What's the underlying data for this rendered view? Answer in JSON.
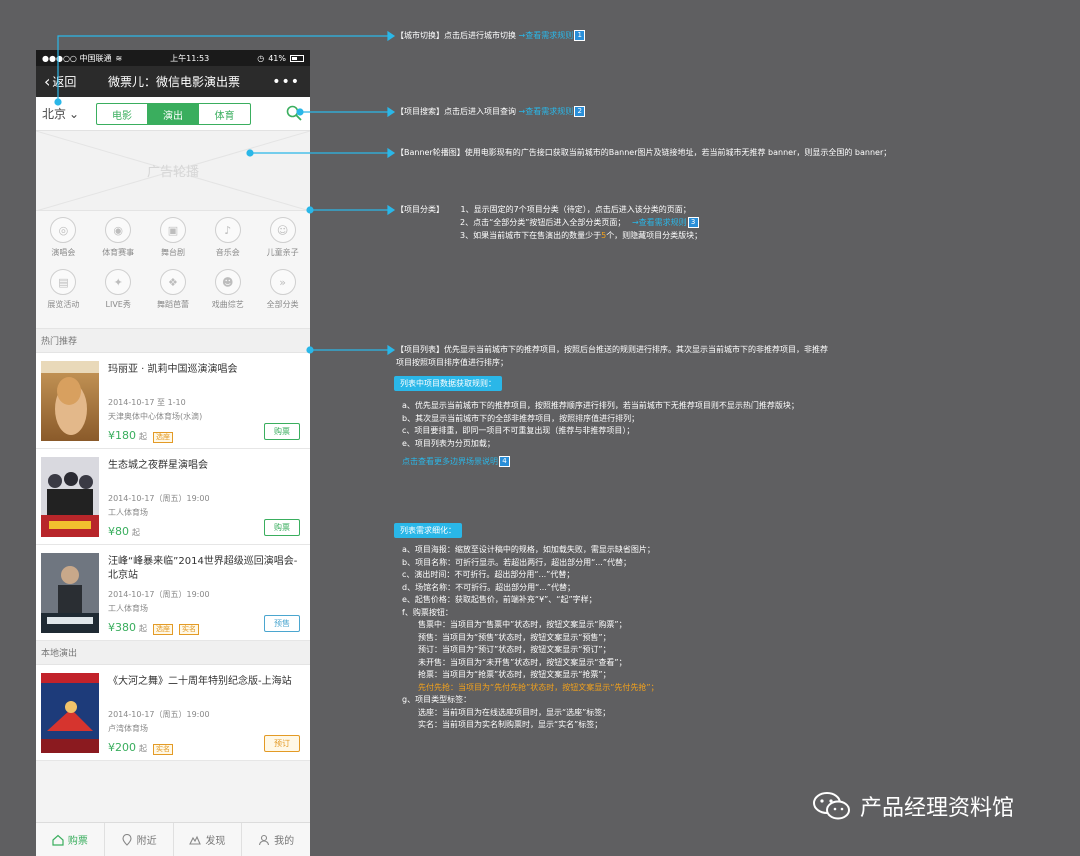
{
  "status": {
    "carrier": "●●●○○ 中国联通",
    "time": "上午11:53",
    "battery": "41%"
  },
  "nav": {
    "back": "返回",
    "title": "微票儿：微信电影演出票",
    "more": "•••"
  },
  "city": "北京",
  "tabs": [
    "电影",
    "演出",
    "体育"
  ],
  "banner_label": "广告轮播",
  "categories_row1": [
    "演唱会",
    "体育赛事",
    "舞台剧",
    "音乐会",
    "儿童亲子"
  ],
  "categories_row2": [
    "展览活动",
    "LIVE秀",
    "舞蹈芭蕾",
    "戏曲综艺",
    "全部分类"
  ],
  "hot_title": "热门推荐",
  "local_title": "本地演出",
  "items": [
    {
      "name": "玛丽亚 · 凯莉中国巡演演唱会",
      "date": "2014-10-17 至 1-10",
      "venue": "天津奥体中心体育场(水滴)",
      "price": "¥180",
      "qi": "起",
      "tags": [
        "选座"
      ],
      "button": "购票"
    },
    {
      "name": "生态城之夜群星演唱会",
      "date": "2014-10-17（周五）19:00",
      "venue": "工人体育场",
      "price": "¥80",
      "qi": "起",
      "tags": [],
      "button": "购票"
    },
    {
      "name": "汪峰“峰暴来临”2014世界超级巡回演唱会-北京站",
      "date": "2014-10-17（周五）19:00",
      "venue": "工人体育场",
      "price": "¥380",
      "qi": "起",
      "tags": [
        "选座",
        "实名"
      ],
      "button": "预售"
    },
    {
      "name": "《大河之舞》二十周年特别纪念版-上海站",
      "date": "2014-10-17（周五）19:00",
      "venue": "卢湾体育场",
      "price": "¥200",
      "qi": "起",
      "tags": [
        "实名"
      ],
      "button": "预订"
    }
  ],
  "tabbar": [
    "购票",
    "附近",
    "发现",
    "我的"
  ],
  "annotations": {
    "a1": {
      "text": "【城市切换】点击后进行城市切换",
      "link": "→查看需求规则",
      "num": "1"
    },
    "a2": {
      "text": "【项目搜索】点击后进入项目查询",
      "link": "→查看需求规则",
      "num": "2"
    },
    "a3": {
      "text": "【Banner轮播图】使用电影现有的广告接口获取当前城市的Banner图片及链接地址，若当前城市无推荐 banner，则显示全国的 banner；"
    },
    "a4": {
      "head": "【项目分类】",
      "l1": "1、显示固定的7个项目分类（待定），点击后进入该分类的页面；",
      "l2": "2、点击“全部分类”按钮后进入全部分类页面；",
      "l2link": "→查看需求规则",
      "num": "3",
      "l3a": "3、如果当前城市下在售演出的数量少于",
      "l3n": "5",
      "l3b": "个，则隐藏项目分类版块；"
    },
    "a5": {
      "l1": "【项目列表】优先显示当前城市下的推荐项目，按照后台推送的规则进行排序。其次显示当前城市下的非推荐项目，非推荐",
      "l2": "项目按照项目排序值进行排序；",
      "pill": "列表中项目数据获取规则：",
      "r1": "a、优先显示当前城市下的推荐项目，按照推荐顺序进行排列，若当前城市下无推荐项目则不显示热门推荐版块；",
      "r2": "b、其次显示当前城市下的全部非推荐项目，按照排序值进行排列；",
      "r3": "c、项目要排重，即同一项目不可重复出现（推荐与非推荐项目）；",
      "r4": "e、项目列表为分页加载；",
      "link": "点击查看更多边界场景说明",
      "num": "4"
    },
    "a6": {
      "pill": "列表需求细化：",
      "lines": [
        "a、项目海报：缩放至设计稿中的规格，如加载失败，需显示缺省图片；",
        "b、项目名称：可折行显示。若超出两行，超出部分用“...”代替；",
        "c、演出时间：不可折行。超出部分用“...”代替；",
        "d、场馆名称：不可折行。超出部分用“...”代替；",
        "e、起售价格：获取起售价，前端补充“¥”、“起”字样；",
        "f、购票按钮：",
        "售票中：当项目为“售票中”状态时，按钮文案显示“购票”；",
        "预售：当项目为“预售”状态时，按钮文案显示“预售”；",
        "预订：当项目为“预订”状态时，按钮文案显示“预订”；",
        "未开售：当项目为“未开售”状态时，按钮文案显示“查看”；",
        "抢票：当项目为“抢票”状态时，按钮文案显示“抢票”；",
        "先付先抢：当项目为“先付先抢”状态时，按钮文案显示“先付先抢”；",
        "g、项目类型标签：",
        "选座：当前项目为在线选座项目时，显示“选座”标签；",
        "实名：当前项目为实名制购票时，显示“实名”标签；"
      ]
    }
  },
  "brand": "产品经理资料馆",
  "colors": {
    "accent": "#3aae5e",
    "link": "#2ab7e8",
    "bg": "#5f5f61",
    "orange": "#e39a25"
  }
}
